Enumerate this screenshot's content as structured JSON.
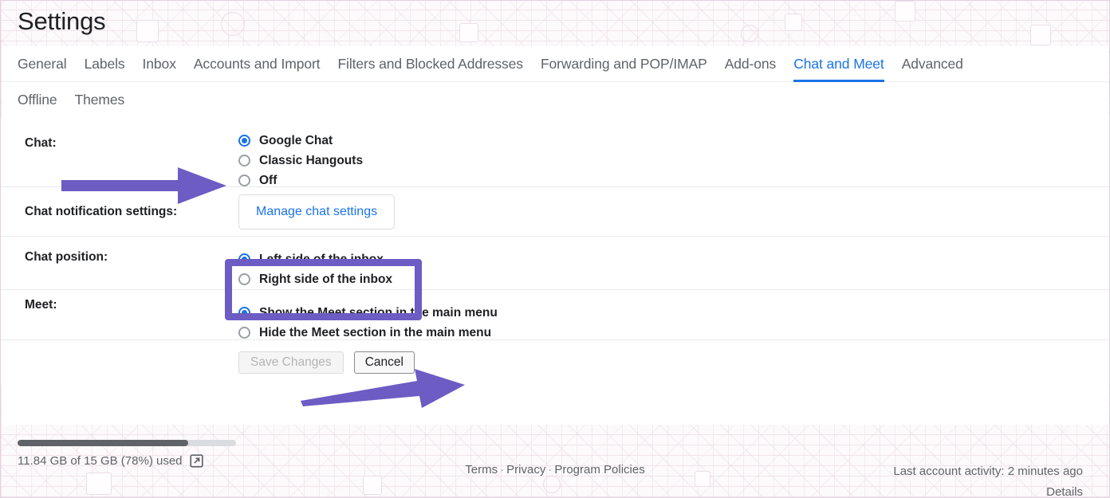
{
  "page": {
    "title": "Settings",
    "accent_blue": "#1a73e8",
    "annotation_purple": "#6c5cc4",
    "border_pink": "#e3d2df"
  },
  "tabs": {
    "row1": [
      {
        "label": "General",
        "active": false
      },
      {
        "label": "Labels",
        "active": false
      },
      {
        "label": "Inbox",
        "active": false
      },
      {
        "label": "Accounts and Import",
        "active": false
      },
      {
        "label": "Filters and Blocked Addresses",
        "active": false
      },
      {
        "label": "Forwarding and POP/IMAP",
        "active": false
      },
      {
        "label": "Add-ons",
        "active": false
      },
      {
        "label": "Chat and Meet",
        "active": true
      },
      {
        "label": "Advanced",
        "active": false
      }
    ],
    "row2": [
      {
        "label": "Offline",
        "active": false
      },
      {
        "label": "Themes",
        "active": false
      }
    ]
  },
  "settings": {
    "chat": {
      "label": "Chat:",
      "options": [
        {
          "label": "Google Chat",
          "selected": true
        },
        {
          "label": "Classic Hangouts",
          "selected": false
        },
        {
          "label": "Off",
          "selected": false
        }
      ]
    },
    "chat_notifications": {
      "label": "Chat notification settings:",
      "button_label": "Manage chat settings"
    },
    "chat_position": {
      "label": "Chat position:",
      "options": [
        {
          "label": "Left side of the inbox",
          "selected": true
        },
        {
          "label": "Right side of the inbox",
          "selected": false
        }
      ]
    },
    "meet": {
      "label": "Meet:",
      "options": [
        {
          "label": "Show the Meet section in the main menu",
          "selected": true
        },
        {
          "label": "Hide the Meet section in the main menu",
          "selected": false
        }
      ]
    },
    "actions": {
      "save_label": "Save Changes",
      "save_disabled": true,
      "cancel_label": "Cancel"
    }
  },
  "footer": {
    "storage_text": "11.84 GB of 15 GB (78%) used",
    "storage_percent": 78,
    "links": [
      {
        "label": "Terms"
      },
      {
        "label": "Privacy"
      },
      {
        "label": "Program Policies"
      }
    ],
    "separator": "·",
    "activity_text": "Last account activity: 2 minutes ago",
    "details_label": "Details"
  }
}
